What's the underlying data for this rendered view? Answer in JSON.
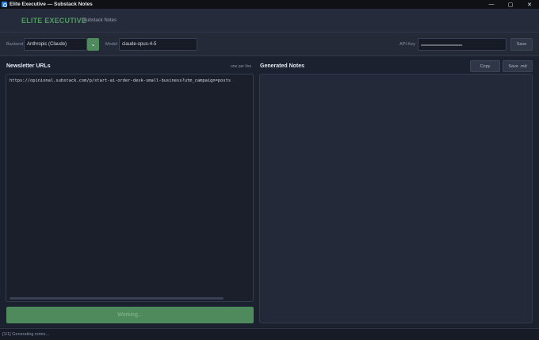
{
  "window": {
    "title": "Elite Executive — Substack Notes",
    "controls": [
      "—",
      "▢",
      "✕"
    ]
  },
  "header": {
    "brand": "ELITE EXECUTIVE",
    "subtitle": "Substack Notes"
  },
  "toolbar": {
    "backend_label": "Backend",
    "backend_value": "Anthropic (Claude)",
    "model_label": "Model",
    "model_value": "claude-opus-4-5",
    "api_key_label": "API Key",
    "api_key_value": "••••••••••••••••••••••••••••••••••••••••••••••••••••",
    "save_label": "Save"
  },
  "urls_panel": {
    "title": "Newsletter URLs",
    "hint": "one per line",
    "content": "https://opinional.substack.com/p/start-ai-order-desk-small-business?utm_campaign=posts",
    "action_label": "Working..."
  },
  "notes_panel": {
    "title": "Generated Notes",
    "copy_label": "Copy",
    "save_md_label": "Save .md",
    "content": ""
  },
  "status": {
    "text": "[1/1] Generating notes..."
  },
  "colors": {
    "accent": "#4f8a5c",
    "brand": "#4f9a63",
    "background": "#1c2130"
  }
}
